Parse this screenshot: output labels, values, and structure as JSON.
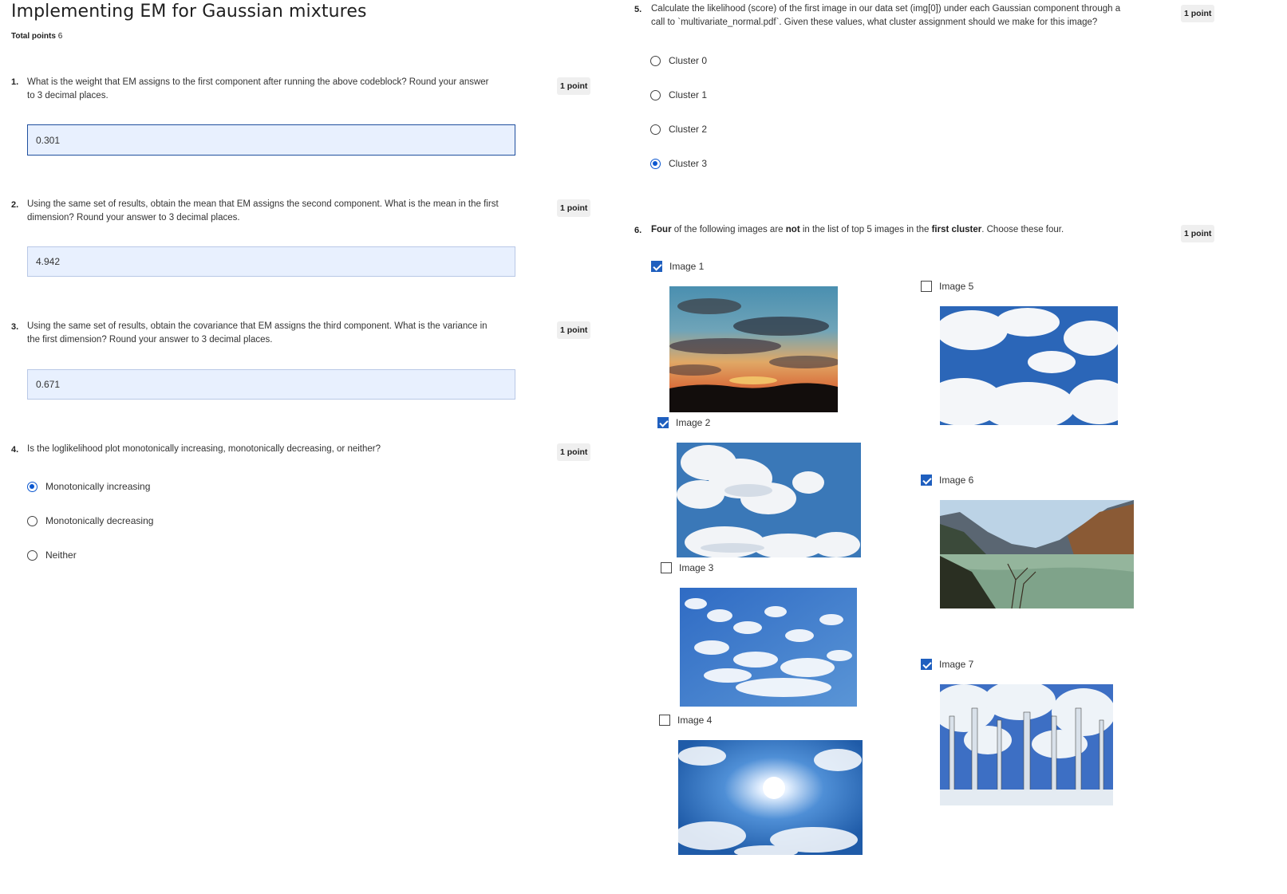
{
  "page": {
    "title": "Implementing EM for Gaussian mixtures",
    "total_label": "Total points",
    "total_value": "6"
  },
  "questions": [
    {
      "num": "1.",
      "line1": "What is the weight that EM assigns to the first component after running the above codeblock? Round your answer",
      "line2": "to 3 decimal places.",
      "points": "1 point",
      "answer": "0.301"
    },
    {
      "num": "2.",
      "line1": "Using the same set of results, obtain the mean that EM assigns the second component. What is the mean in the first",
      "line2": "dimension? Round your answer to 3 decimal places.",
      "points": "1 point",
      "answer": "4.942"
    },
    {
      "num": "3.",
      "line1": "Using the same set of results, obtain the covariance that EM assigns the third component. What is the variance in",
      "line2": "the first dimension? Round your answer to 3 decimal places.",
      "points": "1 point",
      "answer": "0.671"
    },
    {
      "num": "4.",
      "line1": "Is the loglikelihood plot monotonically increasing, monotonically decreasing, or neither?",
      "points": "1 point",
      "options": [
        "Monotonically increasing",
        "Monotonically decreasing",
        "Neither"
      ],
      "selected": 0
    },
    {
      "num": "5.",
      "line1": "Calculate the likelihood (score) of the first image in our data set (img[0]) under each Gaussian component through a",
      "line2": "call to `multivariate_normal.pdf`.  Given these values, what cluster assignment should we make for this image?",
      "points": "1 point",
      "options": [
        "Cluster 0",
        "Cluster 1",
        "Cluster 2",
        "Cluster 3"
      ],
      "selected": 3
    },
    {
      "num": "6.",
      "part1": "Four",
      "part2": " of the following images are ",
      "part3": "not",
      "part4": " in the list of top 5 images in the ",
      "part5": "first cluster",
      "part6": ". Choose these four.",
      "points": "1 point",
      "images": [
        {
          "label": "Image 1",
          "checked": true
        },
        {
          "label": "Image 2",
          "checked": true
        },
        {
          "label": "Image 3",
          "checked": false
        },
        {
          "label": "Image 4",
          "checked": false
        },
        {
          "label": "Image 5",
          "checked": false
        },
        {
          "label": "Image 6",
          "checked": true
        },
        {
          "label": "Image 7",
          "checked": true
        }
      ]
    }
  ],
  "colors": {
    "accent": "#0b57d0",
    "answer_bg": "#e8f0fe",
    "badge_bg": "#efefef"
  }
}
